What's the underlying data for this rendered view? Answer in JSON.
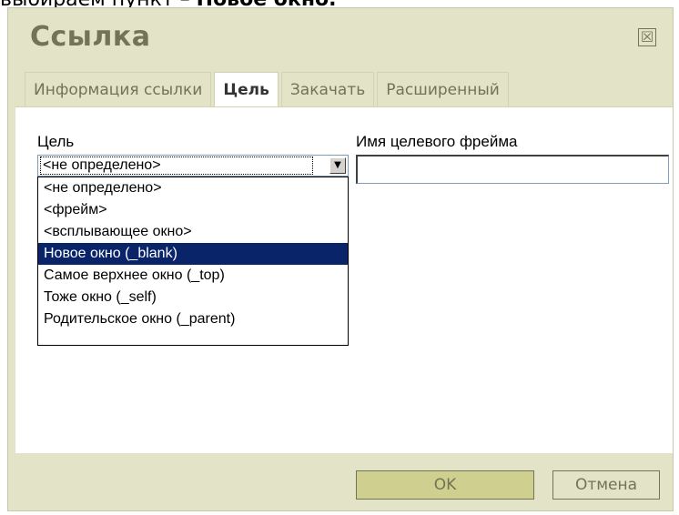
{
  "caption": {
    "prefix": "выбираем пункт – ",
    "bold": "Новое окно."
  },
  "dialog": {
    "title": "Ссылка",
    "close_glyph": "☒"
  },
  "tabs": [
    {
      "label": "Информация ссылки",
      "active": false
    },
    {
      "label": "Цель",
      "active": true
    },
    {
      "label": "Закачать",
      "active": false
    },
    {
      "label": "Расширенный",
      "active": false
    }
  ],
  "target": {
    "label": "Цель",
    "value": "<не определено>",
    "options": [
      "<не определено>",
      "<фрейм>",
      "<всплывающее окно>",
      "Новое окно (_blank)",
      "Самое верхнее окно (_top)",
      "Тоже окно (_self)",
      "Родительское окно (_parent)"
    ],
    "highlighted_index": 3
  },
  "frame_name": {
    "label": "Имя целевого фрейма",
    "value": ""
  },
  "buttons": {
    "ok": "OK",
    "cancel": "Отмена"
  },
  "colors": {
    "dialog_bg": "#e3e3c7",
    "title": "#737357",
    "highlight": "#0a246a"
  },
  "icons": {
    "close": "close-icon",
    "dropdown_arrow": "chevron-down-icon"
  }
}
